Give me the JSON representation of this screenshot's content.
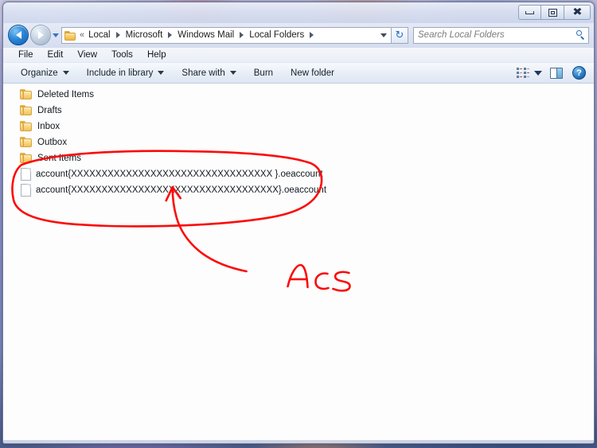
{
  "window": {
    "controls": {
      "minimize": "Minimize",
      "maximize": "Maximize",
      "close": "Close"
    }
  },
  "navigation": {
    "back_label": "Back",
    "forward_label": "Forward",
    "recent_pages_label": "Recent pages",
    "refresh_label": "Refresh",
    "refresh_glyph": "↻"
  },
  "breadcrumb": {
    "overflow_glyph": "«",
    "segments": [
      {
        "label": "Local"
      },
      {
        "label": "Microsoft"
      },
      {
        "label": "Windows Mail"
      },
      {
        "label": "Local Folders"
      }
    ]
  },
  "search": {
    "placeholder": "Search Local Folders",
    "value": ""
  },
  "menubar": {
    "items": [
      {
        "label": "File"
      },
      {
        "label": "Edit"
      },
      {
        "label": "View"
      },
      {
        "label": "Tools"
      },
      {
        "label": "Help"
      }
    ]
  },
  "commandbar": {
    "buttons": [
      {
        "label": "Organize",
        "has_caret": true
      },
      {
        "label": "Include in library",
        "has_caret": true
      },
      {
        "label": "Share with",
        "has_caret": true
      },
      {
        "label": "Burn",
        "has_caret": false
      },
      {
        "label": "New folder",
        "has_caret": false
      }
    ],
    "view_options_label": "Change your view",
    "preview_pane_label": "Show the preview pane",
    "help_label": "Get help",
    "help_glyph": "?"
  },
  "filelist": {
    "items": [
      {
        "name": "Deleted Items",
        "type": "folder"
      },
      {
        "name": "Drafts",
        "type": "folder"
      },
      {
        "name": "Inbox",
        "type": "folder"
      },
      {
        "name": "Outbox",
        "type": "folder"
      },
      {
        "name": "Sent Items",
        "type": "folder"
      },
      {
        "name": "account{XXXXXXXXXXXXXXXXXXXXXXXXXXXXXXXXX }.oeaccount",
        "type": "file"
      },
      {
        "name": "account{XXXXXXXXXXXXXXXXXXXXXXXXXXXXXXXXXX}.oeaccount",
        "type": "file"
      }
    ]
  },
  "annotation": {
    "color": "#fb0a0a",
    "handwritten_text": "Acs",
    "ellipse_label": "hand-drawn-ellipse-around-account-files",
    "arrow_label": "hand-drawn-arrow-pointing-to-account-files"
  }
}
